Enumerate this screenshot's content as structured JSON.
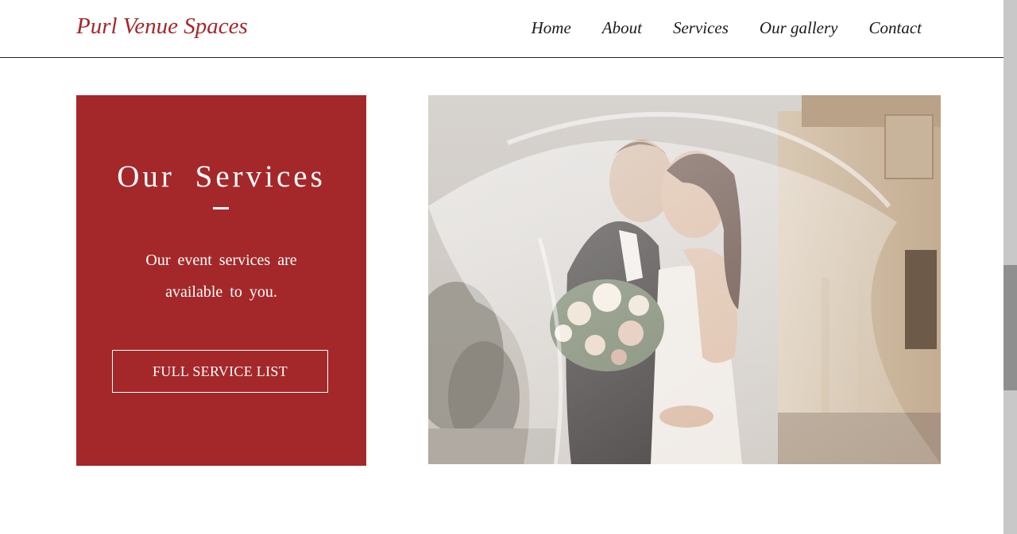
{
  "header": {
    "brand": "Purl Venue Spaces",
    "nav": [
      {
        "label": "Home"
      },
      {
        "label": "About"
      },
      {
        "label": "Services"
      },
      {
        "label": "Our gallery"
      },
      {
        "label": "Contact"
      }
    ]
  },
  "services_card": {
    "title": "Our Services",
    "description": "Our event services are available to you.",
    "button_label": "FULL SERVICE LIST"
  },
  "photo": {
    "icon": "wedding-couple-photo"
  },
  "colors": {
    "brand": "#a4282a",
    "text": "#1a1a1a",
    "background": "#ffffff",
    "scrollbar_track": "#c8c8c8",
    "scrollbar_thumb": "#8f8f8f"
  }
}
